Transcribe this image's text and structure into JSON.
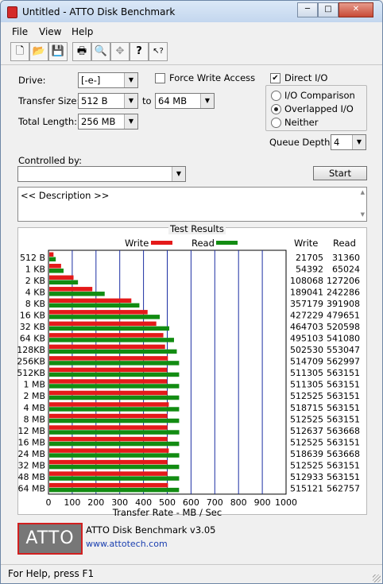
{
  "window": {
    "title": "Untitled - ATTO Disk Benchmark",
    "btn_min": "─",
    "btn_max": "□",
    "btn_close": "✕"
  },
  "menu": [
    "File",
    "View",
    "Help"
  ],
  "toolbar": [
    {
      "name": "new-icon",
      "glyph": "🗋"
    },
    {
      "name": "open-icon",
      "glyph": "📂"
    },
    {
      "name": "save-icon",
      "glyph": "💾"
    },
    {
      "name": "print-icon",
      "glyph": "🖶"
    },
    {
      "name": "print-preview-icon",
      "glyph": "🔍"
    },
    {
      "name": "move-icon",
      "glyph": "✥"
    },
    {
      "name": "help-icon",
      "glyph": "?"
    },
    {
      "name": "context-help-icon",
      "glyph": "↖?"
    }
  ],
  "settings": {
    "drive_label": "Drive:",
    "drive_value": "[-e-]",
    "force_write_label": "Force Write Access",
    "direct_io_label": "Direct I/O",
    "direct_io_checked": "✔",
    "transfer_size_label": "Transfer Size:",
    "transfer_from": "512 B",
    "to_label": "to",
    "transfer_to": "64 MB",
    "total_length_label": "Total Length:",
    "total_length_value": "256 MB",
    "io_comparison_label": "I/O Comparison",
    "overlapped_io_label": "Overlapped I/O",
    "neither_label": "Neither",
    "queue_depth_label": "Queue Depth:",
    "queue_depth_value": "4",
    "controlled_by_label": "Controlled by:",
    "controlled_by_value": "",
    "start_label": "Start",
    "description": "<< Description >>"
  },
  "results": {
    "title": "Test Results",
    "legend_write": "Write",
    "legend_read": "Read",
    "col_write": "Write",
    "col_read": "Read",
    "write_color": "#e41a1a",
    "read_color": "#128c12"
  },
  "chart_data": {
    "type": "bar",
    "orientation": "horizontal",
    "categories": [
      "512 B",
      "1 KB",
      "2 KB",
      "4 KB",
      "8 KB",
      "16 KB",
      "32 KB",
      "64 KB",
      "128KB",
      "256KB",
      "512KB",
      "1 MB",
      "2 MB",
      "4 MB",
      "8 MB",
      "12 MB",
      "16 MB",
      "24 MB",
      "32 MB",
      "48 MB",
      "64 MB"
    ],
    "series": [
      {
        "name": "Write",
        "values": [
          21705,
          54392,
          108068,
          189041,
          357179,
          427229,
          464703,
          495103,
          502530,
          514709,
          511305,
          511305,
          512525,
          518715,
          512525,
          512637,
          512525,
          518639,
          512525,
          512933,
          515121
        ]
      },
      {
        "name": "Read",
        "values": [
          31360,
          65024,
          127206,
          242286,
          391908,
          479651,
          520598,
          541080,
          553047,
          562997,
          563151,
          563151,
          563151,
          563151,
          563151,
          563668,
          563151,
          563668,
          563151,
          563151,
          562757
        ]
      }
    ],
    "xlabel": "Transfer Rate - MB / Sec",
    "xlim": [
      0,
      1000
    ],
    "x_ticks": [
      "0",
      "100",
      "200",
      "300",
      "400",
      "500",
      "600",
      "700",
      "800",
      "900",
      "1000"
    ],
    "grid": true
  },
  "footer": {
    "logo": "ATTO",
    "product": "ATTO Disk Benchmark v3.05",
    "url": "www.attotech.com"
  },
  "status": "For Help, press F1"
}
